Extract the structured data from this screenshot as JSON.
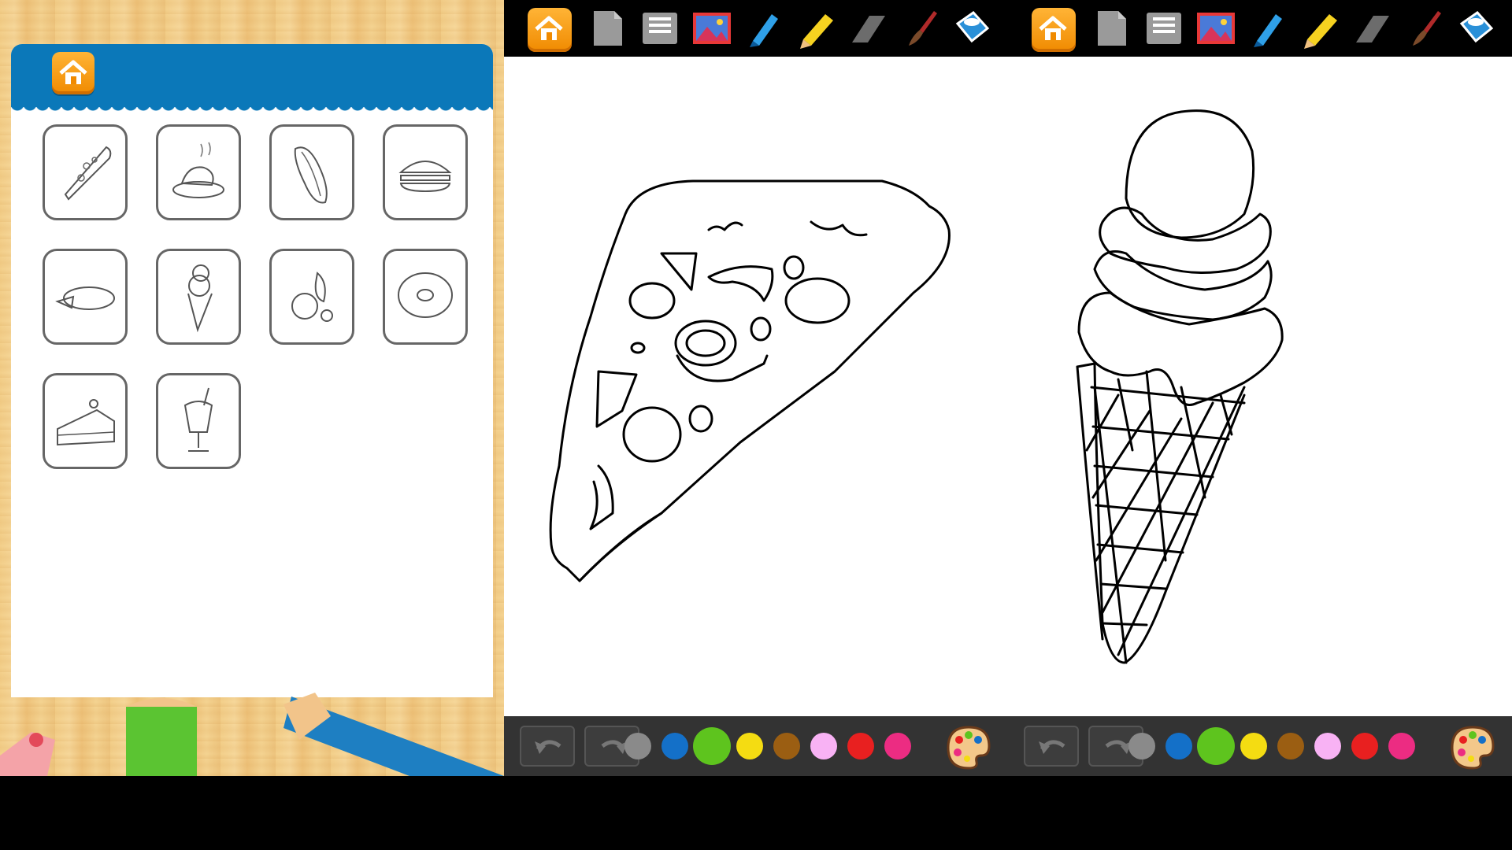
{
  "left_panel": {
    "home_icon": "home-icon",
    "thumbnails": [
      {
        "name": "pizza-slice",
        "icon": "pizza-icon"
      },
      {
        "name": "roast-chicken",
        "icon": "chicken-icon"
      },
      {
        "name": "hot-dog",
        "icon": "hotdog-icon"
      },
      {
        "name": "burger",
        "icon": "burger-icon"
      },
      {
        "name": "pie",
        "icon": "pie-icon"
      },
      {
        "name": "ice-cream",
        "icon": "icecream-icon"
      },
      {
        "name": "fruits",
        "icon": "fruit-icon"
      },
      {
        "name": "donut",
        "icon": "donut-icon"
      },
      {
        "name": "cake-slice",
        "icon": "cake-icon"
      },
      {
        "name": "milkshake",
        "icon": "milkshake-icon"
      }
    ]
  },
  "toolbar": {
    "tools": [
      "home-icon",
      "new-page-icon",
      "save-icon",
      "gallery-icon",
      "pen-icon",
      "pencil-icon",
      "eraser-icon",
      "brush-icon",
      "fill-bucket-icon"
    ],
    "accent": "#f39a12"
  },
  "colors": [
    "#8a8a8a",
    "#1470c8",
    "#5ec41e",
    "#f4dc12",
    "#9b5e12",
    "#f8b2f4",
    "#e82020",
    "#ec2c82"
  ],
  "canvas": {
    "drawings": [
      "pizza-slice",
      "ice-cream-cone"
    ]
  }
}
